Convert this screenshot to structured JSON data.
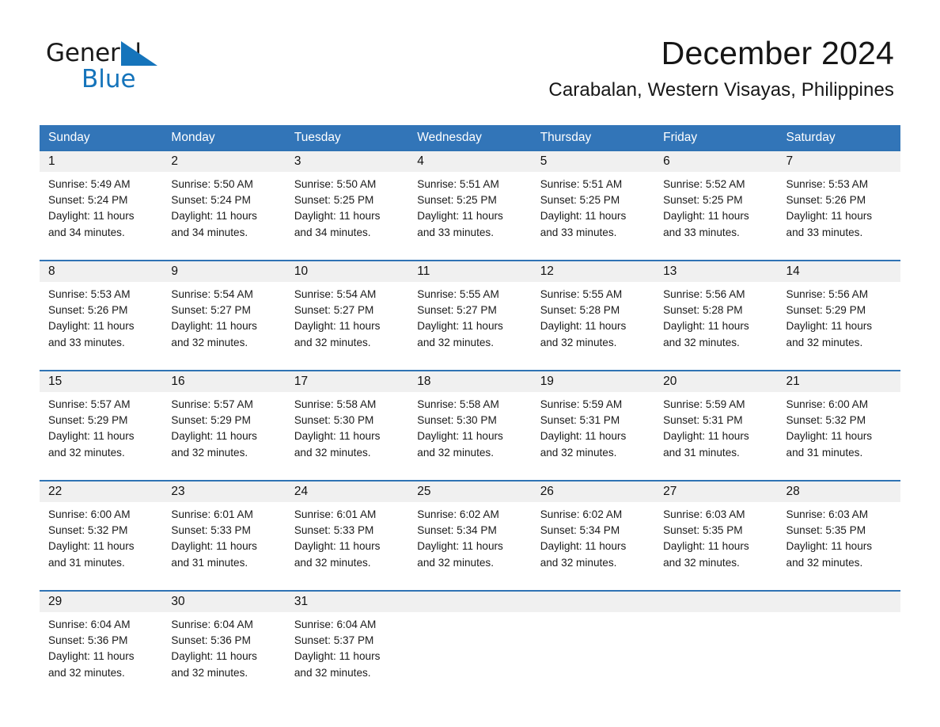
{
  "brand": {
    "name_part1": "General",
    "name_part2": "Blue",
    "accent_color": "#1574bb"
  },
  "header": {
    "title": "December 2024",
    "subtitle": "Carabalan, Western Visayas, Philippines"
  },
  "theme": {
    "header_row_bg": "#3275b8",
    "row_divider": "#2f73b4",
    "daynum_bg": "#f0f0f0",
    "text": "#1a1a1a"
  },
  "weekdays": [
    "Sunday",
    "Monday",
    "Tuesday",
    "Wednesday",
    "Thursday",
    "Friday",
    "Saturday"
  ],
  "weeks": [
    [
      {
        "day": "1",
        "sunrise": "Sunrise: 5:49 AM",
        "sunset": "Sunset: 5:24 PM",
        "daylight_line1": "Daylight: 11 hours",
        "daylight_line2": "and 34 minutes."
      },
      {
        "day": "2",
        "sunrise": "Sunrise: 5:50 AM",
        "sunset": "Sunset: 5:24 PM",
        "daylight_line1": "Daylight: 11 hours",
        "daylight_line2": "and 34 minutes."
      },
      {
        "day": "3",
        "sunrise": "Sunrise: 5:50 AM",
        "sunset": "Sunset: 5:25 PM",
        "daylight_line1": "Daylight: 11 hours",
        "daylight_line2": "and 34 minutes."
      },
      {
        "day": "4",
        "sunrise": "Sunrise: 5:51 AM",
        "sunset": "Sunset: 5:25 PM",
        "daylight_line1": "Daylight: 11 hours",
        "daylight_line2": "and 33 minutes."
      },
      {
        "day": "5",
        "sunrise": "Sunrise: 5:51 AM",
        "sunset": "Sunset: 5:25 PM",
        "daylight_line1": "Daylight: 11 hours",
        "daylight_line2": "and 33 minutes."
      },
      {
        "day": "6",
        "sunrise": "Sunrise: 5:52 AM",
        "sunset": "Sunset: 5:25 PM",
        "daylight_line1": "Daylight: 11 hours",
        "daylight_line2": "and 33 minutes."
      },
      {
        "day": "7",
        "sunrise": "Sunrise: 5:53 AM",
        "sunset": "Sunset: 5:26 PM",
        "daylight_line1": "Daylight: 11 hours",
        "daylight_line2": "and 33 minutes."
      }
    ],
    [
      {
        "day": "8",
        "sunrise": "Sunrise: 5:53 AM",
        "sunset": "Sunset: 5:26 PM",
        "daylight_line1": "Daylight: 11 hours",
        "daylight_line2": "and 33 minutes."
      },
      {
        "day": "9",
        "sunrise": "Sunrise: 5:54 AM",
        "sunset": "Sunset: 5:27 PM",
        "daylight_line1": "Daylight: 11 hours",
        "daylight_line2": "and 32 minutes."
      },
      {
        "day": "10",
        "sunrise": "Sunrise: 5:54 AM",
        "sunset": "Sunset: 5:27 PM",
        "daylight_line1": "Daylight: 11 hours",
        "daylight_line2": "and 32 minutes."
      },
      {
        "day": "11",
        "sunrise": "Sunrise: 5:55 AM",
        "sunset": "Sunset: 5:27 PM",
        "daylight_line1": "Daylight: 11 hours",
        "daylight_line2": "and 32 minutes."
      },
      {
        "day": "12",
        "sunrise": "Sunrise: 5:55 AM",
        "sunset": "Sunset: 5:28 PM",
        "daylight_line1": "Daylight: 11 hours",
        "daylight_line2": "and 32 minutes."
      },
      {
        "day": "13",
        "sunrise": "Sunrise: 5:56 AM",
        "sunset": "Sunset: 5:28 PM",
        "daylight_line1": "Daylight: 11 hours",
        "daylight_line2": "and 32 minutes."
      },
      {
        "day": "14",
        "sunrise": "Sunrise: 5:56 AM",
        "sunset": "Sunset: 5:29 PM",
        "daylight_line1": "Daylight: 11 hours",
        "daylight_line2": "and 32 minutes."
      }
    ],
    [
      {
        "day": "15",
        "sunrise": "Sunrise: 5:57 AM",
        "sunset": "Sunset: 5:29 PM",
        "daylight_line1": "Daylight: 11 hours",
        "daylight_line2": "and 32 minutes."
      },
      {
        "day": "16",
        "sunrise": "Sunrise: 5:57 AM",
        "sunset": "Sunset: 5:29 PM",
        "daylight_line1": "Daylight: 11 hours",
        "daylight_line2": "and 32 minutes."
      },
      {
        "day": "17",
        "sunrise": "Sunrise: 5:58 AM",
        "sunset": "Sunset: 5:30 PM",
        "daylight_line1": "Daylight: 11 hours",
        "daylight_line2": "and 32 minutes."
      },
      {
        "day": "18",
        "sunrise": "Sunrise: 5:58 AM",
        "sunset": "Sunset: 5:30 PM",
        "daylight_line1": "Daylight: 11 hours",
        "daylight_line2": "and 32 minutes."
      },
      {
        "day": "19",
        "sunrise": "Sunrise: 5:59 AM",
        "sunset": "Sunset: 5:31 PM",
        "daylight_line1": "Daylight: 11 hours",
        "daylight_line2": "and 32 minutes."
      },
      {
        "day": "20",
        "sunrise": "Sunrise: 5:59 AM",
        "sunset": "Sunset: 5:31 PM",
        "daylight_line1": "Daylight: 11 hours",
        "daylight_line2": "and 31 minutes."
      },
      {
        "day": "21",
        "sunrise": "Sunrise: 6:00 AM",
        "sunset": "Sunset: 5:32 PM",
        "daylight_line1": "Daylight: 11 hours",
        "daylight_line2": "and 31 minutes."
      }
    ],
    [
      {
        "day": "22",
        "sunrise": "Sunrise: 6:00 AM",
        "sunset": "Sunset: 5:32 PM",
        "daylight_line1": "Daylight: 11 hours",
        "daylight_line2": "and 31 minutes."
      },
      {
        "day": "23",
        "sunrise": "Sunrise: 6:01 AM",
        "sunset": "Sunset: 5:33 PM",
        "daylight_line1": "Daylight: 11 hours",
        "daylight_line2": "and 31 minutes."
      },
      {
        "day": "24",
        "sunrise": "Sunrise: 6:01 AM",
        "sunset": "Sunset: 5:33 PM",
        "daylight_line1": "Daylight: 11 hours",
        "daylight_line2": "and 32 minutes."
      },
      {
        "day": "25",
        "sunrise": "Sunrise: 6:02 AM",
        "sunset": "Sunset: 5:34 PM",
        "daylight_line1": "Daylight: 11 hours",
        "daylight_line2": "and 32 minutes."
      },
      {
        "day": "26",
        "sunrise": "Sunrise: 6:02 AM",
        "sunset": "Sunset: 5:34 PM",
        "daylight_line1": "Daylight: 11 hours",
        "daylight_line2": "and 32 minutes."
      },
      {
        "day": "27",
        "sunrise": "Sunrise: 6:03 AM",
        "sunset": "Sunset: 5:35 PM",
        "daylight_line1": "Daylight: 11 hours",
        "daylight_line2": "and 32 minutes."
      },
      {
        "day": "28",
        "sunrise": "Sunrise: 6:03 AM",
        "sunset": "Sunset: 5:35 PM",
        "daylight_line1": "Daylight: 11 hours",
        "daylight_line2": "and 32 minutes."
      }
    ],
    [
      {
        "day": "29",
        "sunrise": "Sunrise: 6:04 AM",
        "sunset": "Sunset: 5:36 PM",
        "daylight_line1": "Daylight: 11 hours",
        "daylight_line2": "and 32 minutes."
      },
      {
        "day": "30",
        "sunrise": "Sunrise: 6:04 AM",
        "sunset": "Sunset: 5:36 PM",
        "daylight_line1": "Daylight: 11 hours",
        "daylight_line2": "and 32 minutes."
      },
      {
        "day": "31",
        "sunrise": "Sunrise: 6:04 AM",
        "sunset": "Sunset: 5:37 PM",
        "daylight_line1": "Daylight: 11 hours",
        "daylight_line2": "and 32 minutes."
      },
      {
        "day": "",
        "sunrise": "",
        "sunset": "",
        "daylight_line1": "",
        "daylight_line2": ""
      },
      {
        "day": "",
        "sunrise": "",
        "sunset": "",
        "daylight_line1": "",
        "daylight_line2": ""
      },
      {
        "day": "",
        "sunrise": "",
        "sunset": "",
        "daylight_line1": "",
        "daylight_line2": ""
      },
      {
        "day": "",
        "sunrise": "",
        "sunset": "",
        "daylight_line1": "",
        "daylight_line2": ""
      }
    ]
  ]
}
